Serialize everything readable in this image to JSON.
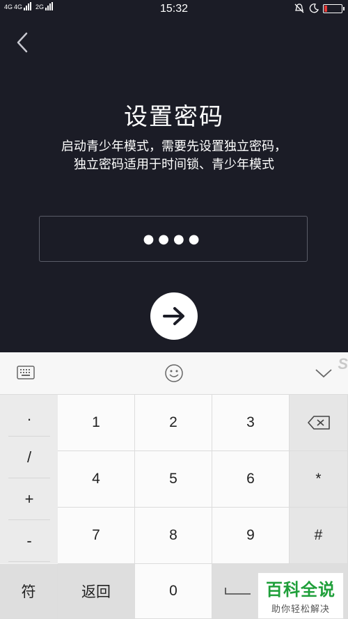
{
  "status": {
    "time": "15:32",
    "net1": "4G",
    "net2": "4G",
    "net3": "2G"
  },
  "title": "设置密码",
  "desc": {
    "line1": "启动青少年模式，需要先设置独立密码，",
    "line2": "独立密码适用于时间锁、青少年模式"
  },
  "password": {
    "masked": "●●●●"
  },
  "keyboard": {
    "symbols": [
      ".",
      "/",
      "+",
      "-"
    ],
    "keys": {
      "k1": "1",
      "k2": "2",
      "k3": "3",
      "k4": "4",
      "k5": "5",
      "k6": "6",
      "k7": "7",
      "k8": "8",
      "k9": "9",
      "k0": "0",
      "star": "*",
      "hash": "#",
      "fu": "符",
      "back": "返回"
    },
    "watermark": "S"
  },
  "brand": {
    "name": "百科全说",
    "slogan": "助你轻松解决"
  },
  "colors": {
    "background": "#1b1c26",
    "battery_low": "#e53935",
    "brand_green": "#1f9f3a"
  }
}
